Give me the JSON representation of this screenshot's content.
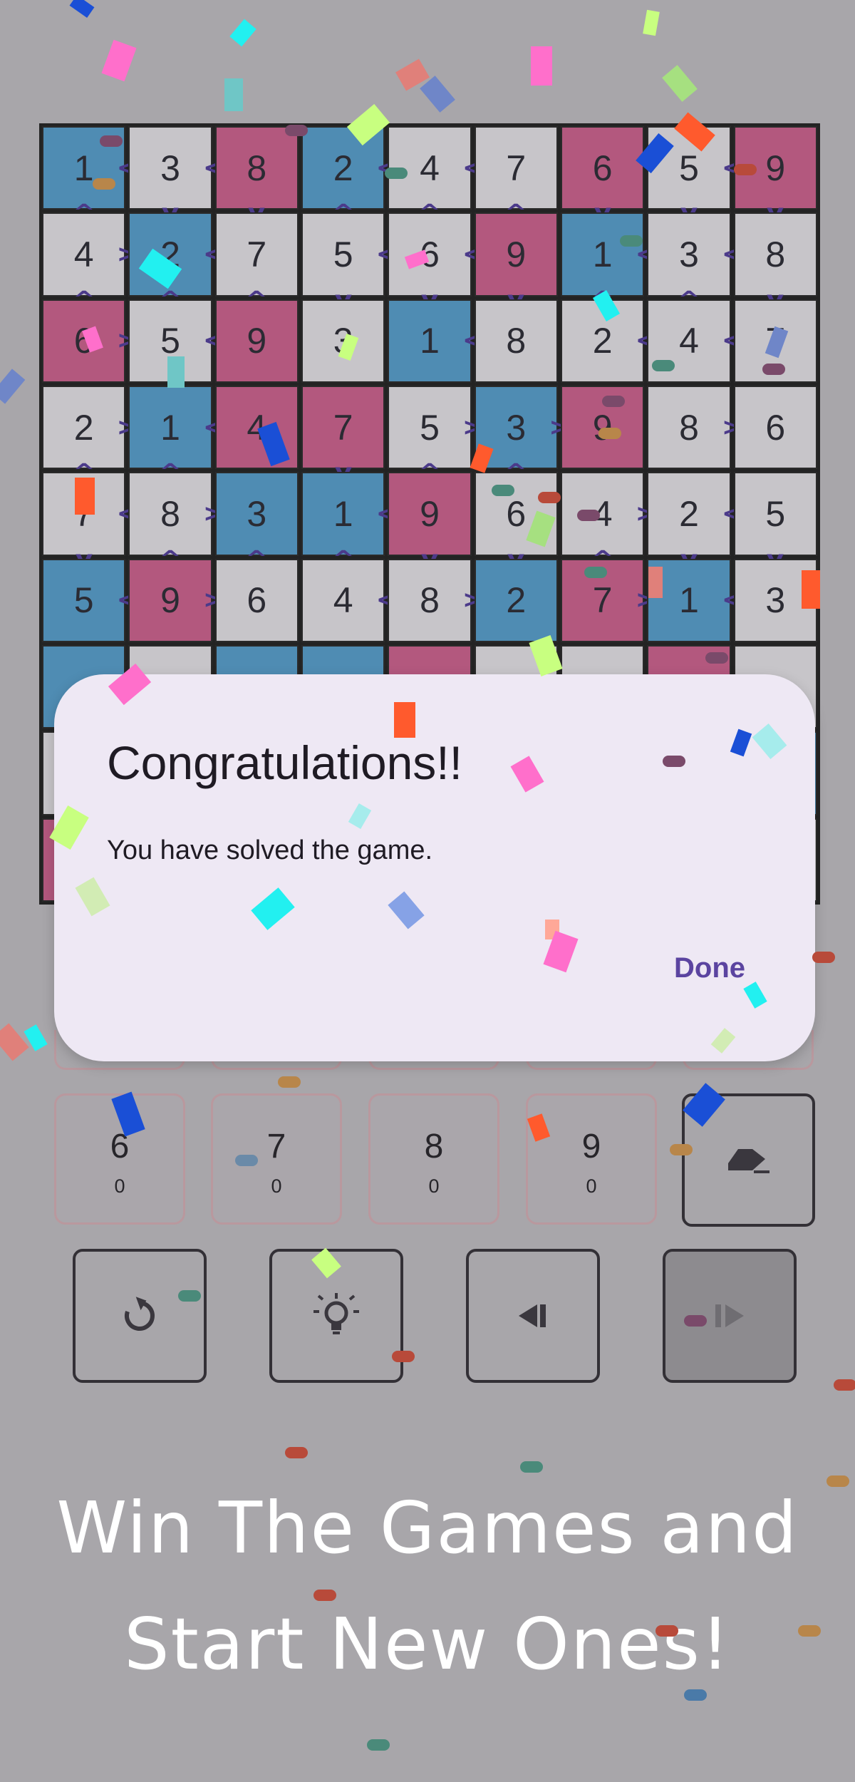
{
  "board": {
    "values": [
      [
        "1",
        "3",
        "8",
        "2",
        "4",
        "7",
        "6",
        "5",
        "9"
      ],
      [
        "4",
        "2",
        "7",
        "5",
        "6",
        "9",
        "1",
        "3",
        "8"
      ],
      [
        "6",
        "5",
        "9",
        "3",
        "1",
        "8",
        "2",
        "4",
        "7"
      ],
      [
        "2",
        "1",
        "4",
        "7",
        "5",
        "3",
        "9",
        "8",
        "6"
      ],
      [
        "7",
        "8",
        "3",
        "1",
        "9",
        "6",
        "4",
        "2",
        "5"
      ],
      [
        "5",
        "9",
        "6",
        "4",
        "8",
        "2",
        "7",
        "1",
        "3"
      ],
      [
        "",
        "",
        "",
        "",
        "",
        "",
        "",
        "",
        ""
      ],
      [
        "",
        "",
        "",
        "",
        "",
        "",
        "",
        "",
        ""
      ],
      [
        "",
        "",
        "",
        "",
        "",
        "",
        "",
        "",
        ""
      ]
    ],
    "colors": [
      [
        "b",
        "g",
        "r",
        "b",
        "g",
        "g",
        "r",
        "g",
        "r"
      ],
      [
        "g",
        "b",
        "g",
        "g",
        "g",
        "r",
        "b",
        "g",
        "g"
      ],
      [
        "r",
        "g",
        "r",
        "g",
        "b",
        "g",
        "g",
        "g",
        "g"
      ],
      [
        "g",
        "b",
        "r",
        "r",
        "g",
        "b",
        "r",
        "g",
        "g"
      ],
      [
        "g",
        "g",
        "b",
        "b",
        "r",
        "g",
        "g",
        "g",
        "g"
      ],
      [
        "b",
        "r",
        "g",
        "g",
        "g",
        "b",
        "r",
        "b",
        "g"
      ],
      [
        "b",
        "g",
        "b",
        "b",
        "r",
        "g",
        "g",
        "r",
        "g"
      ],
      [
        "g",
        "g",
        "g",
        "g",
        "g",
        "g",
        "g",
        "g",
        "b"
      ],
      [
        "r",
        "g",
        "g",
        "g",
        "g",
        "g",
        "g",
        "g",
        "g"
      ]
    ],
    "h_hints": [
      [
        "<",
        "<",
        "",
        "<",
        "<",
        "",
        "",
        "<",
        ""
      ],
      [
        ">",
        "<",
        "",
        "<",
        "<",
        "",
        "<",
        "<",
        ""
      ],
      [
        ">",
        "<",
        "",
        "",
        "<",
        "",
        "<",
        "<",
        ""
      ],
      [
        ">",
        "<",
        "",
        "",
        ">",
        ">",
        "",
        ">",
        ""
      ],
      [
        "<",
        ">",
        "",
        "<",
        "",
        "",
        ">",
        "<",
        ""
      ],
      [
        "<",
        ">",
        "",
        "<",
        ">",
        "",
        ">",
        "<",
        ""
      ],
      [
        "",
        "",
        "",
        "",
        "",
        "",
        "",
        "",
        ""
      ],
      [
        "",
        "",
        "",
        "",
        "",
        "",
        "",
        "",
        ""
      ],
      [
        "",
        "",
        "",
        "",
        "",
        "",
        "",
        "",
        ""
      ]
    ],
    "v_hints": [
      [
        "^",
        "v",
        "v",
        "^",
        "^",
        "^",
        "v",
        "v",
        "v"
      ],
      [
        "^",
        "^",
        "^",
        "v",
        "v",
        "v",
        "^",
        "^",
        "v"
      ],
      [
        "",
        "",
        "",
        "",
        "",
        "",
        "",
        "",
        ""
      ],
      [
        "^",
        "^",
        "",
        "v",
        "^",
        "^",
        "",
        "",
        ""
      ],
      [
        "v",
        "^",
        "^",
        "^",
        "v",
        "v",
        "^",
        "v",
        "v"
      ],
      [
        "",
        "",
        "",
        "",
        "",
        "",
        "",
        "",
        ""
      ],
      [
        "",
        "",
        "",
        "",
        "",
        "",
        "",
        "",
        ""
      ],
      [
        "",
        "",
        "",
        "",
        "",
        "",
        "",
        "",
        ""
      ],
      [
        "",
        "",
        "",
        "",
        "",
        "",
        "",
        "",
        ""
      ]
    ]
  },
  "number_pad": [
    {
      "number": "6",
      "count": "0"
    },
    {
      "number": "7",
      "count": "0"
    },
    {
      "number": "8",
      "count": "0"
    },
    {
      "number": "9",
      "count": "0"
    }
  ],
  "icons": {
    "eraser": "eraser-icon",
    "restart": "restart-icon",
    "hint": "lightbulb-icon",
    "undo": "undo-icon",
    "redo": "redo-icon"
  },
  "dialog": {
    "title": "Congratulations!!",
    "message": "You have solved the game.",
    "done_label": "Done"
  },
  "promo": {
    "line1": "Win The Games and",
    "line2": "Start New Ones!"
  },
  "colors": {
    "background": "#a8a6aa",
    "cell_gray": "#c7c5c9",
    "cell_blue": "#4f8cb3",
    "cell_red": "#b3587e",
    "accent": "#5b44a0"
  }
}
